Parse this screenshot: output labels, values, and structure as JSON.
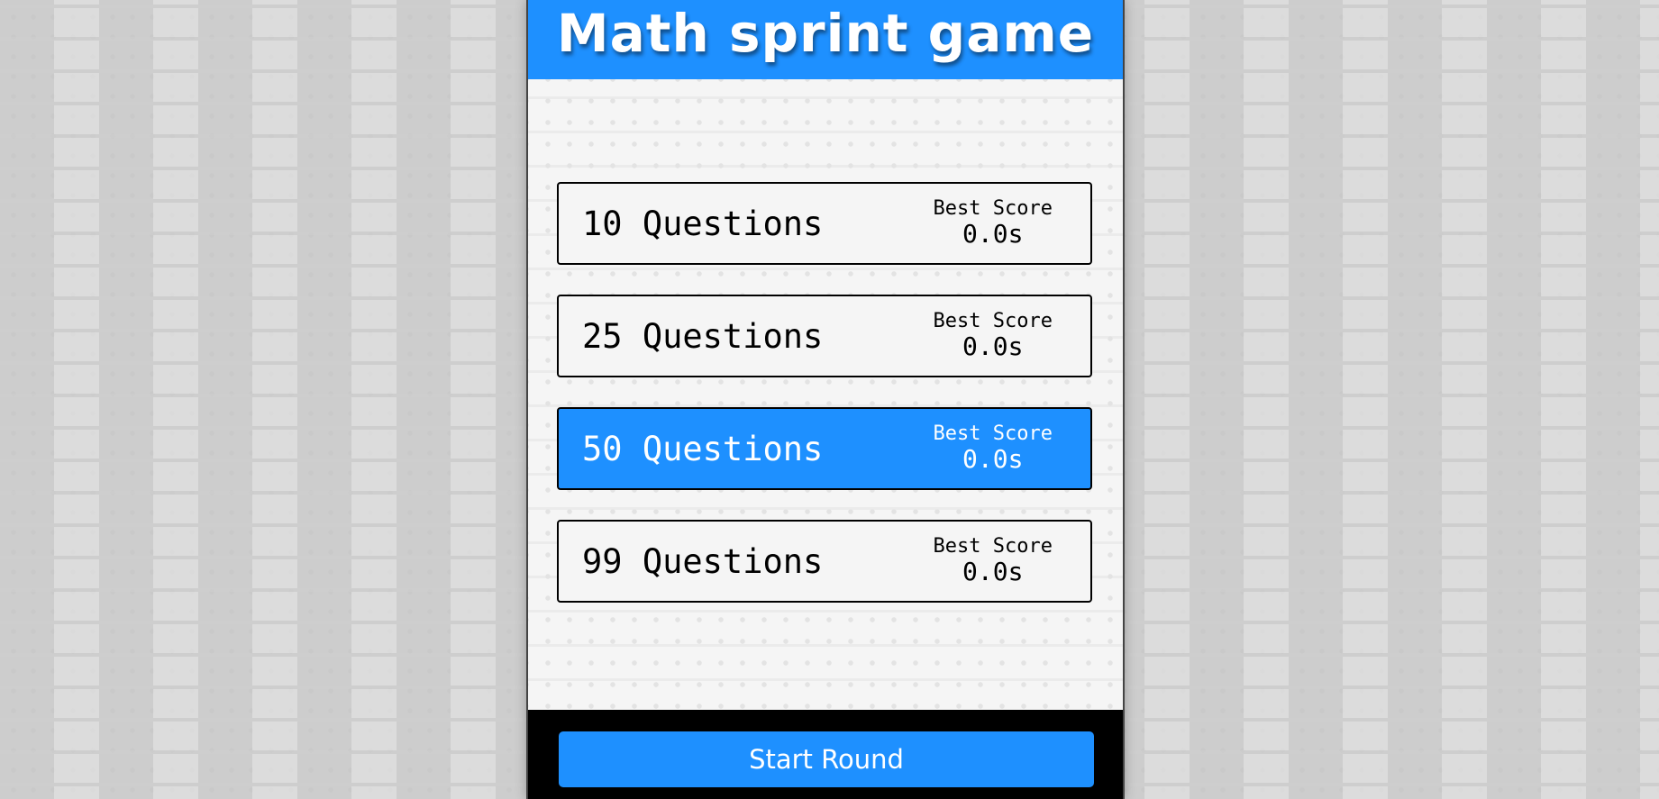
{
  "header": {
    "title": "Math sprint game"
  },
  "options": [
    {
      "label": "10 Questions",
      "score_title": "Best Score",
      "score_value": "0.0s",
      "selected": false
    },
    {
      "label": "25 Questions",
      "score_title": "Best Score",
      "score_value": "0.0s",
      "selected": false
    },
    {
      "label": "50 Questions",
      "score_title": "Best Score",
      "score_value": "0.0s",
      "selected": true
    },
    {
      "label": "99 Questions",
      "score_title": "Best Score",
      "score_value": "0.0s",
      "selected": false
    }
  ],
  "footer": {
    "start_label": "Start Round"
  },
  "colors": {
    "accent": "#1e90ff",
    "footer_bg": "#000000",
    "panel_bg": "#f5f5f5",
    "page_bg": "#ececec"
  }
}
